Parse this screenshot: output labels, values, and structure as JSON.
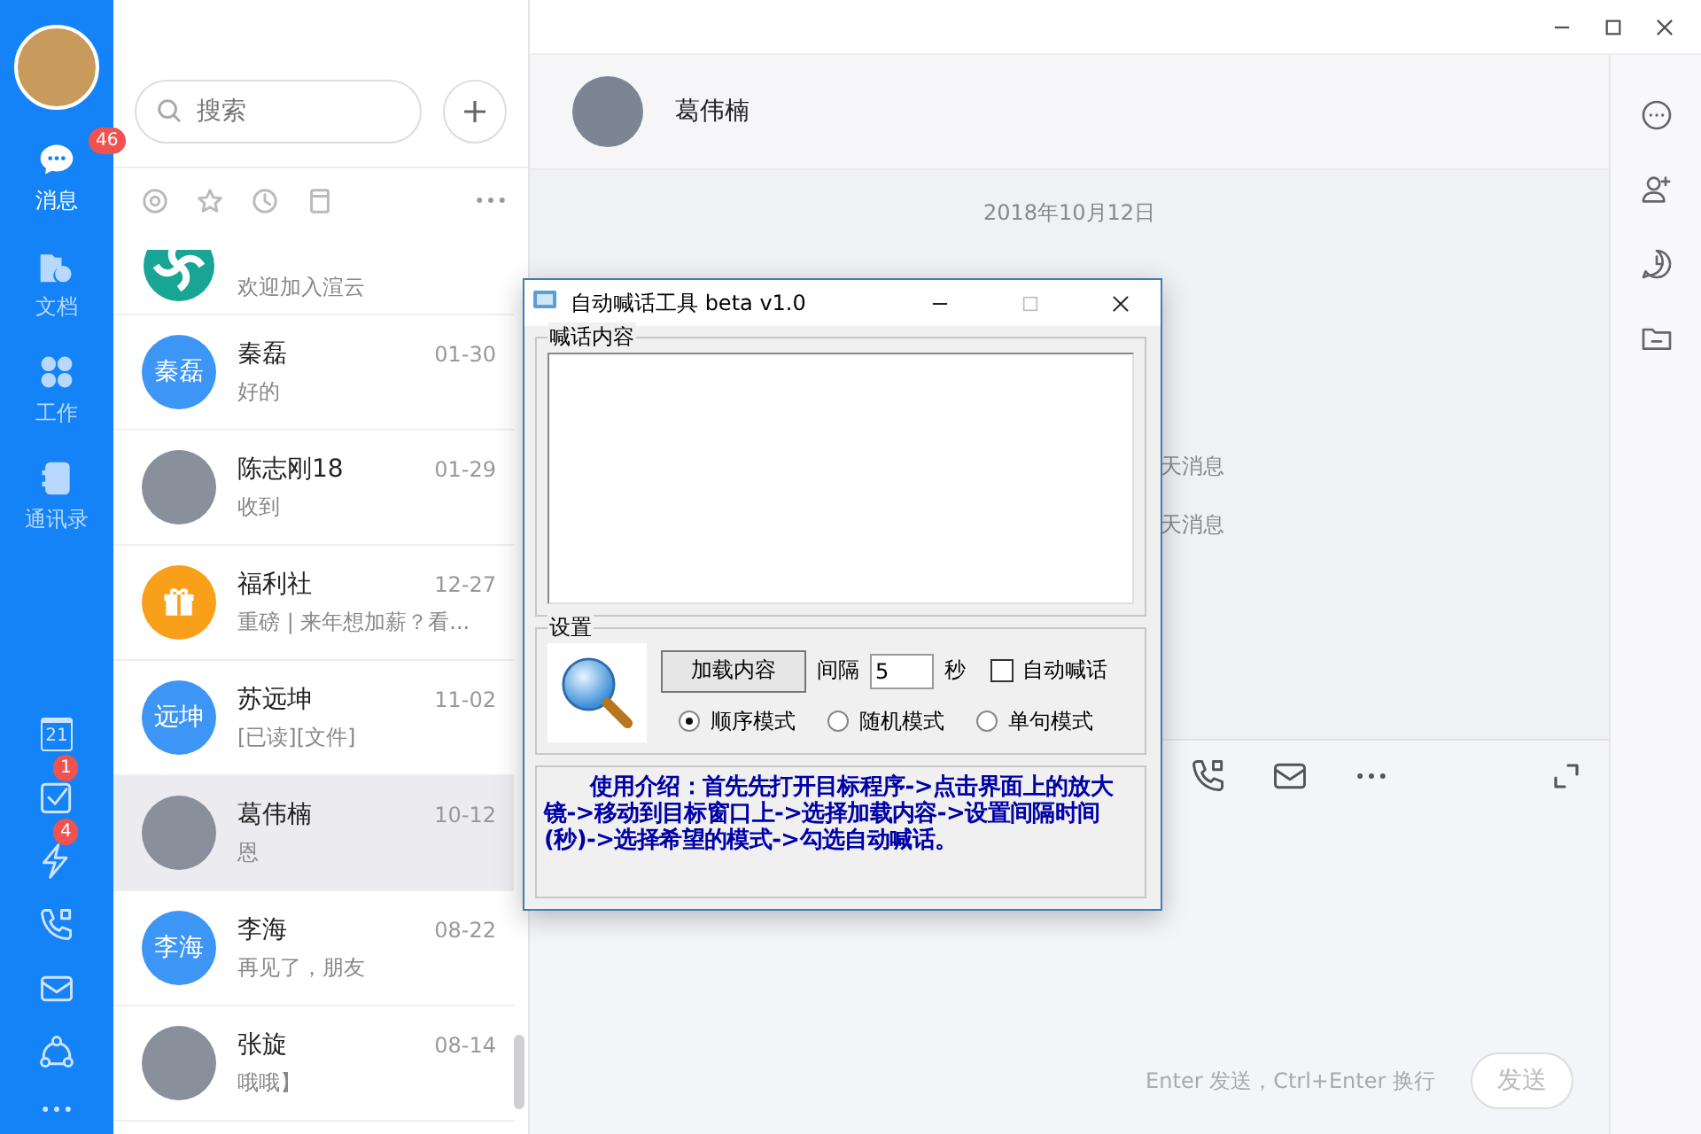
{
  "rail": {
    "items": [
      {
        "label": "消息",
        "kind": "chat",
        "selected": true,
        "badge": "46"
      },
      {
        "label": "文档",
        "kind": "docs",
        "selected": false
      },
      {
        "label": "工作",
        "kind": "work",
        "selected": false
      },
      {
        "label": "通讯录",
        "kind": "contacts",
        "selected": false
      }
    ],
    "tools": [
      {
        "kind": "calendar",
        "text": "21"
      },
      {
        "kind": "task",
        "badge": "1"
      },
      {
        "kind": "bolt",
        "badge": "4"
      },
      {
        "kind": "phone"
      },
      {
        "kind": "mail"
      },
      {
        "kind": "share"
      },
      {
        "kind": "more"
      }
    ]
  },
  "contacts_panel": {
    "search": {
      "placeholder": "搜索"
    },
    "contacts": [
      {
        "kind": "logo",
        "preview": "欢迎加入渲云",
        "selected": false
      },
      {
        "kind": "text",
        "avatar_text": "秦磊",
        "name": "秦磊",
        "time": "01-30",
        "preview": "好的",
        "selected": false
      },
      {
        "kind": "photo",
        "name": "陈志刚18",
        "time": "01-29",
        "preview": "收到",
        "selected": false
      },
      {
        "kind": "gift",
        "name": "福利社",
        "time": "12-27",
        "preview": "重磅 | 来年想加薪？看...",
        "selected": false
      },
      {
        "kind": "text",
        "avatar_text": "远坤",
        "name": "苏远坤",
        "time": "11-02",
        "preview": "[已读][文件]",
        "selected": false
      },
      {
        "kind": "photo",
        "name": "葛伟楠",
        "time": "10-12",
        "preview": "恩",
        "selected": true
      },
      {
        "kind": "text",
        "avatar_text": "李海",
        "name": "李海",
        "time": "08-22",
        "preview": "再见了，朋友",
        "selected": false
      },
      {
        "kind": "photo",
        "name": "张旋",
        "time": "08-14",
        "preview": "哦哦】",
        "selected": false
      }
    ]
  },
  "chat": {
    "name": "葛伟楠",
    "date": "2018年10月12日",
    "notices": [
      "天消息",
      "天消息"
    ],
    "hint": "Enter 发送，Ctrl+Enter 换行",
    "send": "发送"
  },
  "dialog": {
    "title": "自动喊话工具 beta v1.0",
    "content_group": "喊话内容",
    "settings_group": "设置",
    "load_button": "加载内容",
    "interval_label": "间隔",
    "interval": "5",
    "unit": "秒",
    "auto": {
      "label": "自动喊话",
      "checked": false
    },
    "modes": [
      {
        "label": "顺序模式",
        "selected": true
      },
      {
        "label": "随机模式",
        "selected": false
      },
      {
        "label": "单句模式",
        "selected": false
      }
    ],
    "help": "使用介绍：首先先打开目标程序->点击界面上的放大镜->移动到目标窗口上->选择加载内容->设置间隔时间(秒)->选择希望的模式->勾选自动喊话。"
  }
}
